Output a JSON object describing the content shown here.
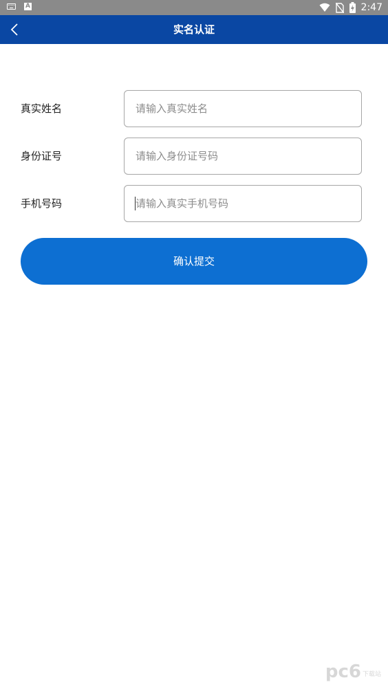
{
  "status_bar": {
    "time": "2:47",
    "left_icons": [
      "keyboard-icon",
      "a-icon"
    ],
    "a_icon_label": "A",
    "right_icons": [
      "wifi-icon",
      "no-sim-icon",
      "battery-charging-icon"
    ]
  },
  "header": {
    "title": "实名认证",
    "back_icon": "chevron-left-icon",
    "background": "#0a47a3"
  },
  "form": {
    "fields": [
      {
        "label": "真实姓名",
        "placeholder": "请输入真实姓名",
        "value": ""
      },
      {
        "label": "身份证号",
        "placeholder": "请输入身份证号码",
        "value": ""
      },
      {
        "label": "手机号码",
        "placeholder": "请输入真实手机号码",
        "value": ""
      }
    ]
  },
  "submit": {
    "label": "确认提交",
    "color": "#0d6fd2"
  },
  "watermark": {
    "text": "pc6",
    "sub": "下载站"
  }
}
